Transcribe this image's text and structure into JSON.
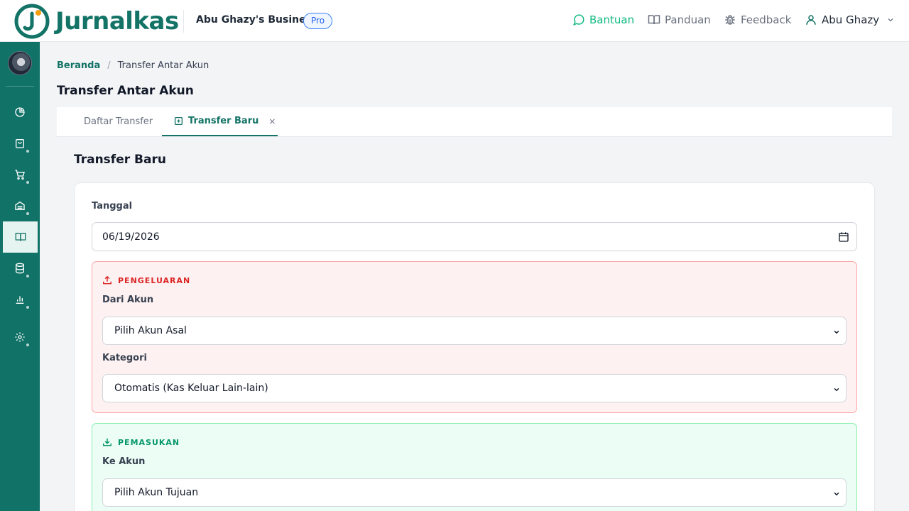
{
  "app": {
    "brand": "Jurnalkas",
    "business_name": "Abu Ghazy's Business",
    "plan_badge": "Pro",
    "accent_color": "#137366",
    "sidebar_color": "#117268"
  },
  "header": {
    "nav": {
      "help": "Bantuan",
      "guide": "Panduan",
      "feedback": "Feedback",
      "user": "Abu Ghazy"
    }
  },
  "sidebar": {
    "items": [
      {
        "icon": "pie-chart-icon"
      },
      {
        "icon": "shopping-bag-icon"
      },
      {
        "icon": "cart-icon"
      },
      {
        "icon": "inventory-icon"
      },
      {
        "icon": "book-icon",
        "active": true
      },
      {
        "icon": "database-icon"
      },
      {
        "icon": "bar-chart-icon"
      },
      {
        "icon": "gear-icon"
      }
    ]
  },
  "breadcrumb": {
    "home": "Beranda",
    "separator": "/",
    "current": "Transfer Antar Akun"
  },
  "page": {
    "title": "Transfer Antar Akun"
  },
  "tabs": {
    "list": "Daftar Transfer",
    "new": "Transfer Baru",
    "close": "×"
  },
  "form": {
    "title": "Transfer Baru",
    "date_label": "Tanggal",
    "date_value": "06/19/2026",
    "outgoing": {
      "heading": "PENGELUARAN",
      "from_label": "Dari Akun",
      "from_value": "Pilih Akun Asal",
      "category_label": "Kategori",
      "category_value": "Otomatis (Kas Keluar Lain-lain)",
      "color": "#dc2626"
    },
    "incoming": {
      "heading": "PEMASUKAN",
      "to_label": "Ke Akun",
      "to_value": "Pilih Akun Tujuan",
      "color": "#059669"
    }
  }
}
